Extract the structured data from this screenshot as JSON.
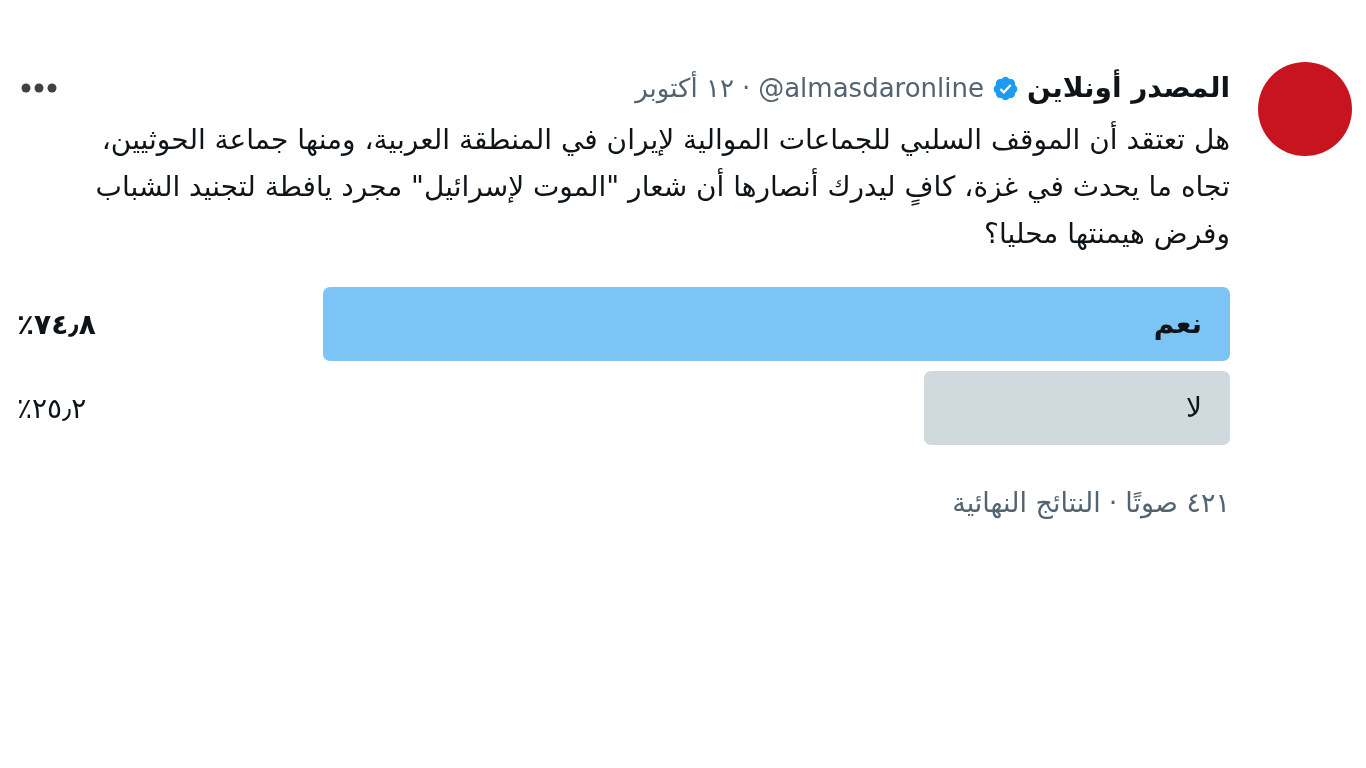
{
  "tweet": {
    "author": {
      "name": "المصدر أونلاين",
      "verified": true,
      "handle": "@almasdaronline"
    },
    "separator": "·",
    "date": "١٢ أكتوبر",
    "text": "هل تعتقد أن الموقف السلبي للجماعات الموالية لإيران في المنطقة العربية، ومنها جماعة الحوثيين، تجاه ما يحدث في غزة، كافٍ ليدرك أنصارها أن شعار \"الموت لإسرائيل\" مجرد يافطة لتجنيد الشباب وفرض هيمنتها محليا؟"
  },
  "poll": {
    "options": [
      {
        "label": "نعم",
        "percent": "٧٤٫٨٪",
        "level": 0.748,
        "leading": true
      },
      {
        "label": "لا",
        "percent": "٢٥٫٢٪",
        "level": 0.252,
        "leading": false
      }
    ],
    "votes": "٤٢١ صوتًا",
    "separator": "·",
    "status": "النتائج النهائية"
  }
}
